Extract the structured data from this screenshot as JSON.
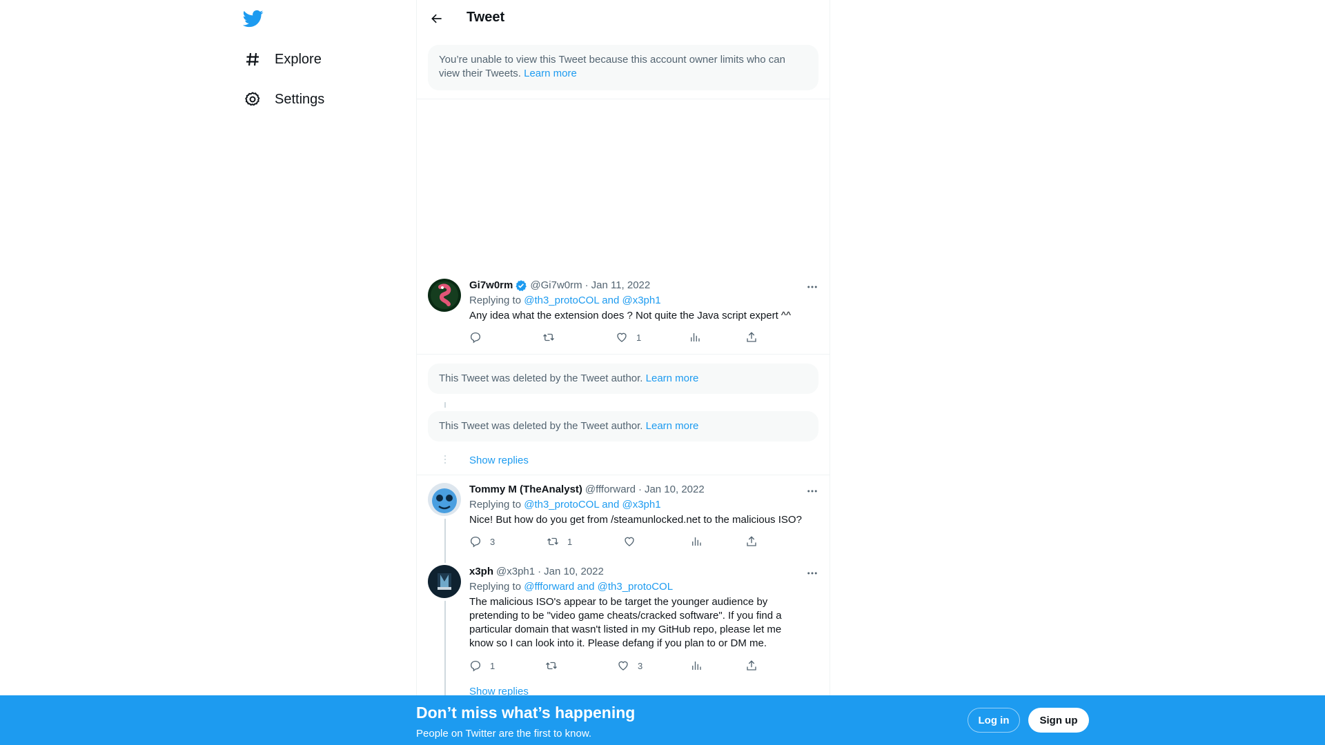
{
  "nav": {
    "items": [
      {
        "label": "Explore",
        "icon": "hashtag-icon"
      },
      {
        "label": "Settings",
        "icon": "gear-icon"
      }
    ]
  },
  "header": {
    "title": "Tweet"
  },
  "restricted_notice": {
    "text": "You’re unable to view this Tweet because this account owner limits who can view their Tweets.",
    "link": "Learn more"
  },
  "tweets": [
    {
      "name": "Gi7w0rm",
      "verified": true,
      "handle": "@Gi7w0rm",
      "date": "Jan 11, 2022",
      "replying_label": "Replying to",
      "replying_to": "@th3_protoCOL and @x3ph1",
      "text": "Any idea what the extension does ? Not quite the Java script expert ^^",
      "replies": "",
      "retweets": "",
      "likes": "1"
    },
    {
      "name": "Tommy M (TheAnalyst)",
      "verified": false,
      "handle": "@ffforward",
      "date": "Jan 10, 2022",
      "replying_label": "Replying to",
      "replying_to": "@th3_protoCOL and @x3ph1",
      "text": "Nice! But how do you get from /steamunlocked.net to the malicious ISO?",
      "replies": "3",
      "retweets": "1",
      "likes": ""
    },
    {
      "name": "x3ph",
      "verified": false,
      "handle": "@x3ph1",
      "date": "Jan 10, 2022",
      "replying_label": "Replying to",
      "replying_to": "@ffforward and @th3_protoCOL",
      "text": "The malicious ISO's appear to be target the younger audience by pretending to be \"video game cheats/cracked software\".  If you find a particular domain that wasn't listed in my GitHub repo, please let me know so I can look into it. Please defang if you plan to or DM me.",
      "replies": "1",
      "retweets": "",
      "likes": "3"
    }
  ],
  "deleted_notices": [
    {
      "text": "This Tweet was deleted by the Tweet author.",
      "link": "Learn more"
    },
    {
      "text": "This Tweet was deleted by the Tweet author.",
      "link": "Learn more"
    }
  ],
  "show_replies": [
    "Show replies",
    "Show replies"
  ],
  "bottom_bar": {
    "title": "Don’t miss what’s happening",
    "subtitle": "People on Twitter are the first to know.",
    "login": "Log in",
    "signup": "Sign up"
  },
  "colors": {
    "accent": "#1d9bf0",
    "text": "#0f1419",
    "secondary": "#536471"
  }
}
